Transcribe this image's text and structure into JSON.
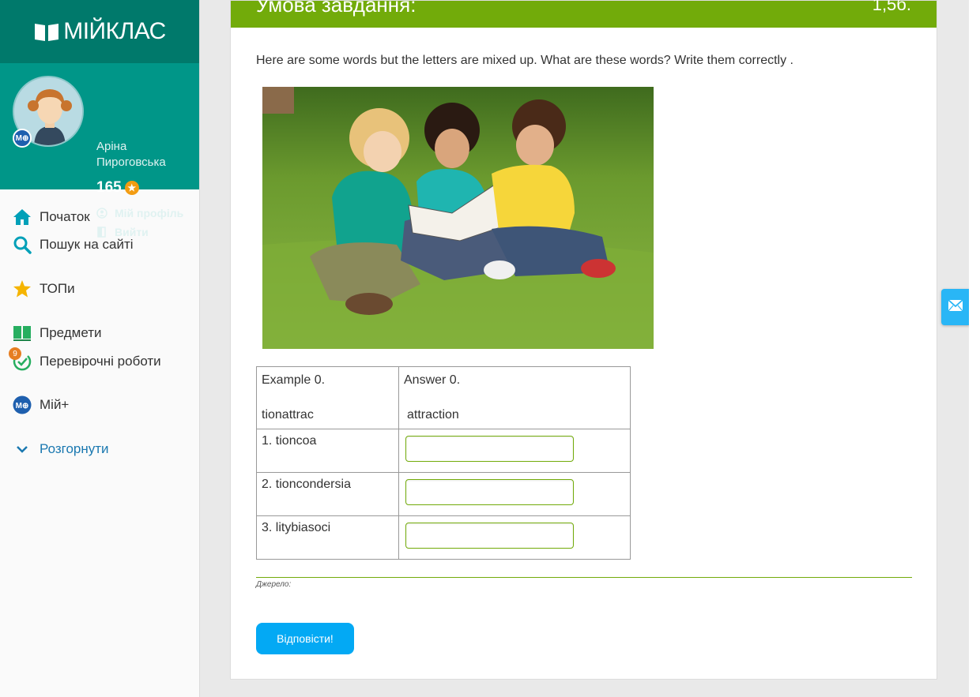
{
  "brand": {
    "logo_text": "МІЙКЛАС"
  },
  "user": {
    "name": "Аріна Пироговська",
    "points": "165",
    "avatar_badge": "M⊕",
    "profile_link": "Мій профіль",
    "logout_link": "Вийти"
  },
  "nav": {
    "items": [
      {
        "label": "Початок",
        "icon": "home-icon"
      },
      {
        "label": "Пошук на сайті",
        "icon": "search-icon"
      },
      {
        "label": "ТОПи",
        "icon": "star-icon"
      },
      {
        "label": "Предмети",
        "icon": "books-icon"
      },
      {
        "label": "Перевірочні роботи",
        "icon": "check-icon",
        "badge": "9"
      },
      {
        "label": "Мій+",
        "icon": "my-plus-icon"
      },
      {
        "label": "Розгорнути",
        "icon": "chevron-down-icon"
      }
    ]
  },
  "task": {
    "title": "Умова завдання:",
    "score": "1,5б.",
    "instruction": "Here are some words but the letters are mixed up. What are these words? Write them correctly .",
    "example": {
      "label": "Example 0.",
      "word": "tionattrac",
      "answer_label": "Answer 0.",
      "answer": "attraction"
    },
    "rows": [
      {
        "word": "1. tioncoa",
        "value": ""
      },
      {
        "word": "2. tioncondersia",
        "value": ""
      },
      {
        "word": "3. litybiasoci",
        "value": ""
      }
    ],
    "source_label": "Джерело:",
    "submit_label": "Відповісти!"
  },
  "colors": {
    "teal_dark": "#00796b",
    "teal": "#009688",
    "header_green": "#72ab0a",
    "submit_blue": "#03a9f4"
  }
}
